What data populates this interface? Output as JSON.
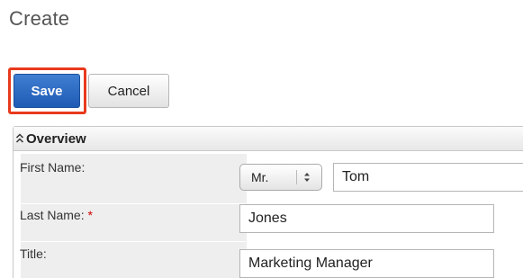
{
  "page": {
    "title": "Create"
  },
  "toolbar": {
    "save_label": "Save",
    "cancel_label": "Cancel"
  },
  "panel": {
    "title": "Overview",
    "icon": "double-chevron-up-icon",
    "fields": {
      "first_name": {
        "label": "First Name:",
        "salutation": "Mr.",
        "value": "Tom"
      },
      "last_name": {
        "label": "Last Name:",
        "required_marker": "*",
        "value": "Jones"
      },
      "title": {
        "label": "Title:",
        "value": "Marketing Manager"
      }
    }
  },
  "colors": {
    "save_button": "#2c6cc4",
    "highlight": "#e83a1d",
    "required": "#cc0000",
    "label_bg": "#eeeeee"
  }
}
